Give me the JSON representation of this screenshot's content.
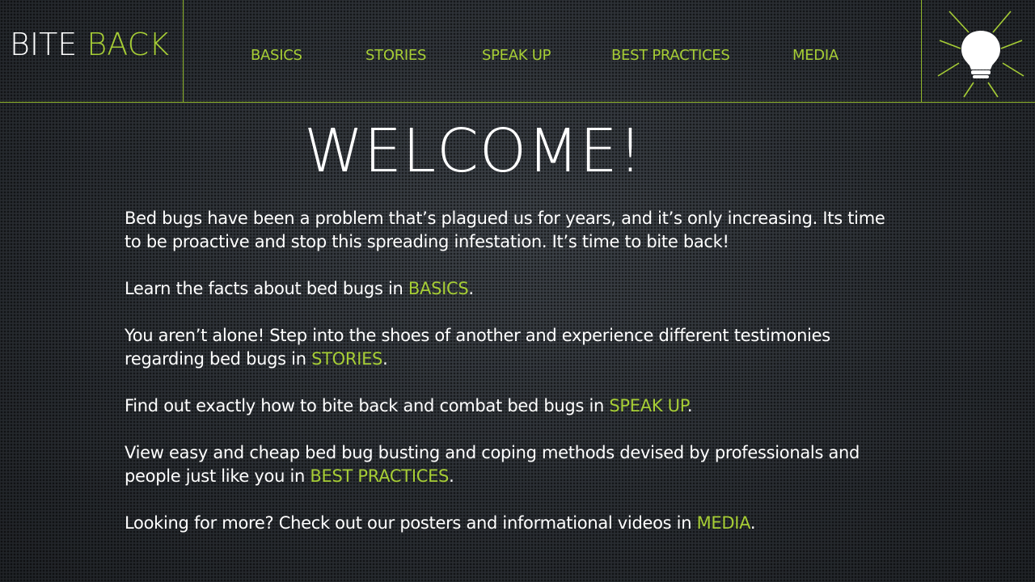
{
  "logo": {
    "word1": "BITE",
    "word2": "BACK"
  },
  "nav": {
    "basics": "BASICS",
    "stories": "STORIES",
    "speak_up": "SPEAK UP",
    "best_practices": "BEST PRACTICES",
    "media": "MEDIA"
  },
  "icon": "lightbulb-icon",
  "colors": {
    "accent": "#a6cd35",
    "text": "#ffffff",
    "background": "#2c3035"
  },
  "title": "WELCOME!",
  "paragraphs": {
    "intro": "Bed bugs have been a problem that’s plagued us for years, and it’s only increasing. Its time to be proactive and stop this spreading infestation. It’s time to bite back!",
    "basics_pre": "Learn the facts about bed bugs in ",
    "basics_link": "BASICS",
    "basics_post": ".",
    "stories_pre": "You aren’t alone! Step into the shoes of another and experience different testimonies regarding bed bugs in ",
    "stories_link": "STORIES",
    "stories_post": ".",
    "speakup_pre": "Find out exactly how to bite back and combat bed bugs in ",
    "speakup_link": "SPEAK UP",
    "speakup_post": ".",
    "best_pre": "View easy and cheap  bed bug busting and coping methods devised by professionals and people just like you in ",
    "best_link": "BEST PRACTICES",
    "best_post": ".",
    "media_pre": "Looking for more? Check out our posters and informational videos in ",
    "media_link": "MEDIA",
    "media_post": "."
  }
}
